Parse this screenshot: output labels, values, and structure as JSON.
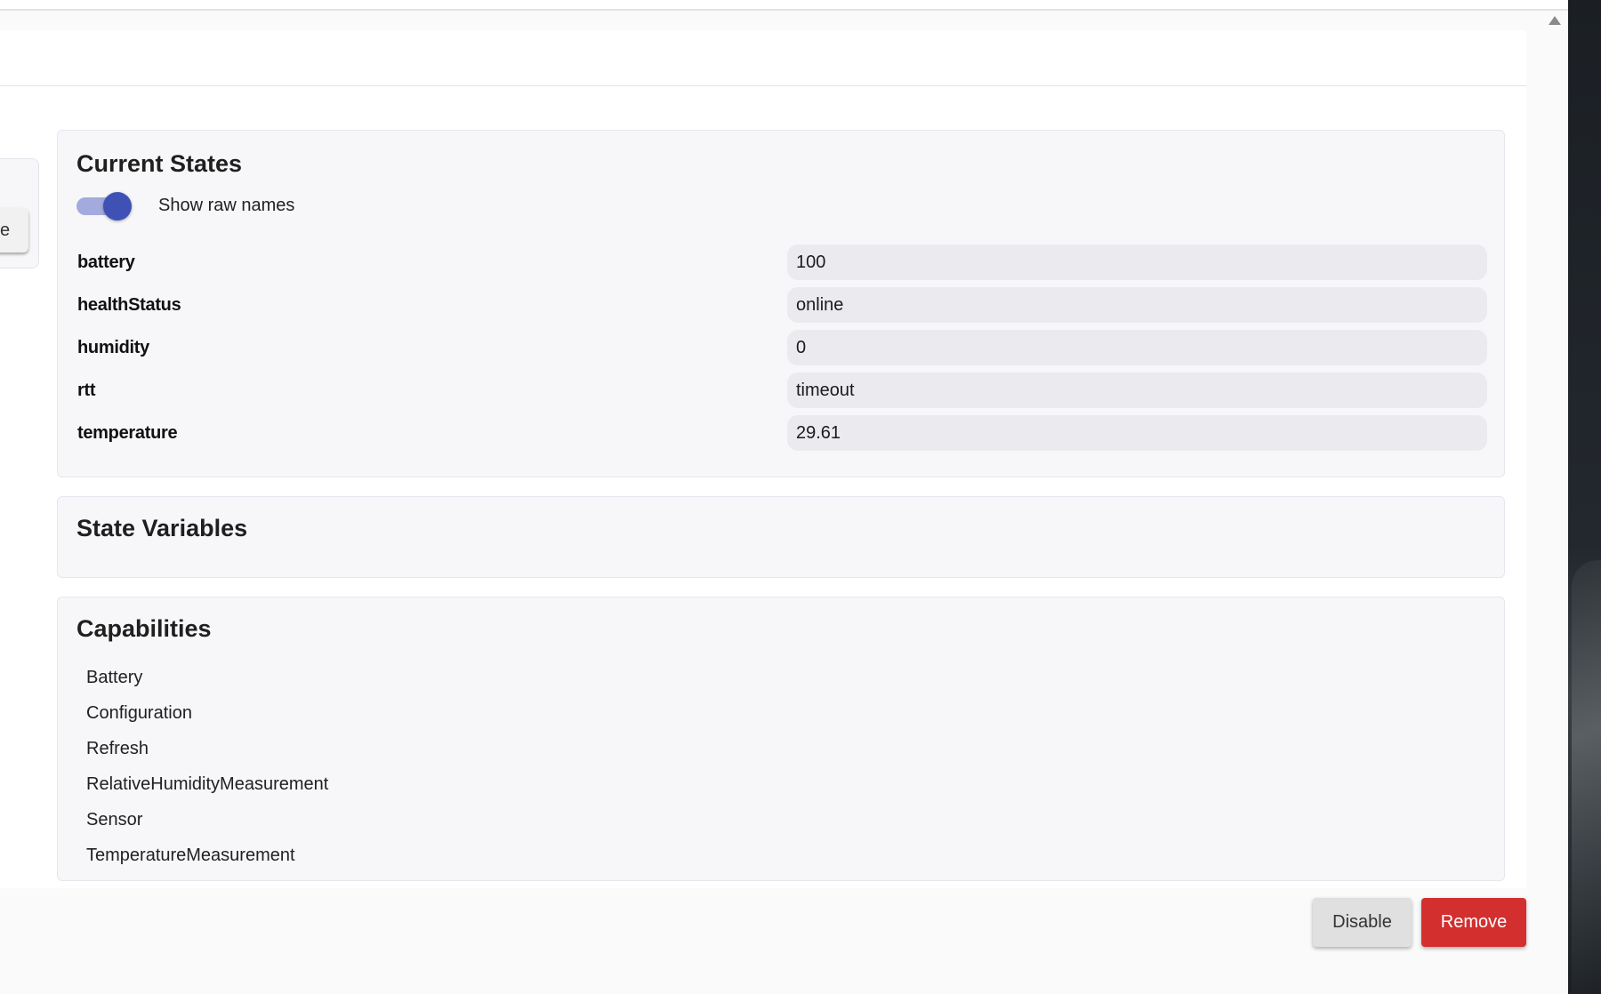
{
  "left_partial_button": {
    "label": "e"
  },
  "current_states": {
    "title": "Current States",
    "toggle_label": "Show raw names",
    "toggle_on": true,
    "rows": [
      {
        "name": "battery",
        "value": "100"
      },
      {
        "name": "healthStatus",
        "value": "online"
      },
      {
        "name": "humidity",
        "value": "0"
      },
      {
        "name": "rtt",
        "value": "timeout"
      },
      {
        "name": "temperature",
        "value": "29.61"
      }
    ]
  },
  "state_variables": {
    "title": "State Variables"
  },
  "capabilities": {
    "title": "Capabilities",
    "items": [
      "Battery",
      "Configuration",
      "Refresh",
      "RelativeHumidityMeasurement",
      "Sensor",
      "TemperatureMeasurement"
    ]
  },
  "footer": {
    "disable_label": "Disable",
    "remove_label": "Remove"
  },
  "colors": {
    "accent": "#3f51b5",
    "toggle_track": "#a3aade",
    "remove_button": "#d32f2f",
    "disable_button": "#e0e0e0"
  },
  "icons": {
    "scroll_up": "scroll-up-icon"
  }
}
